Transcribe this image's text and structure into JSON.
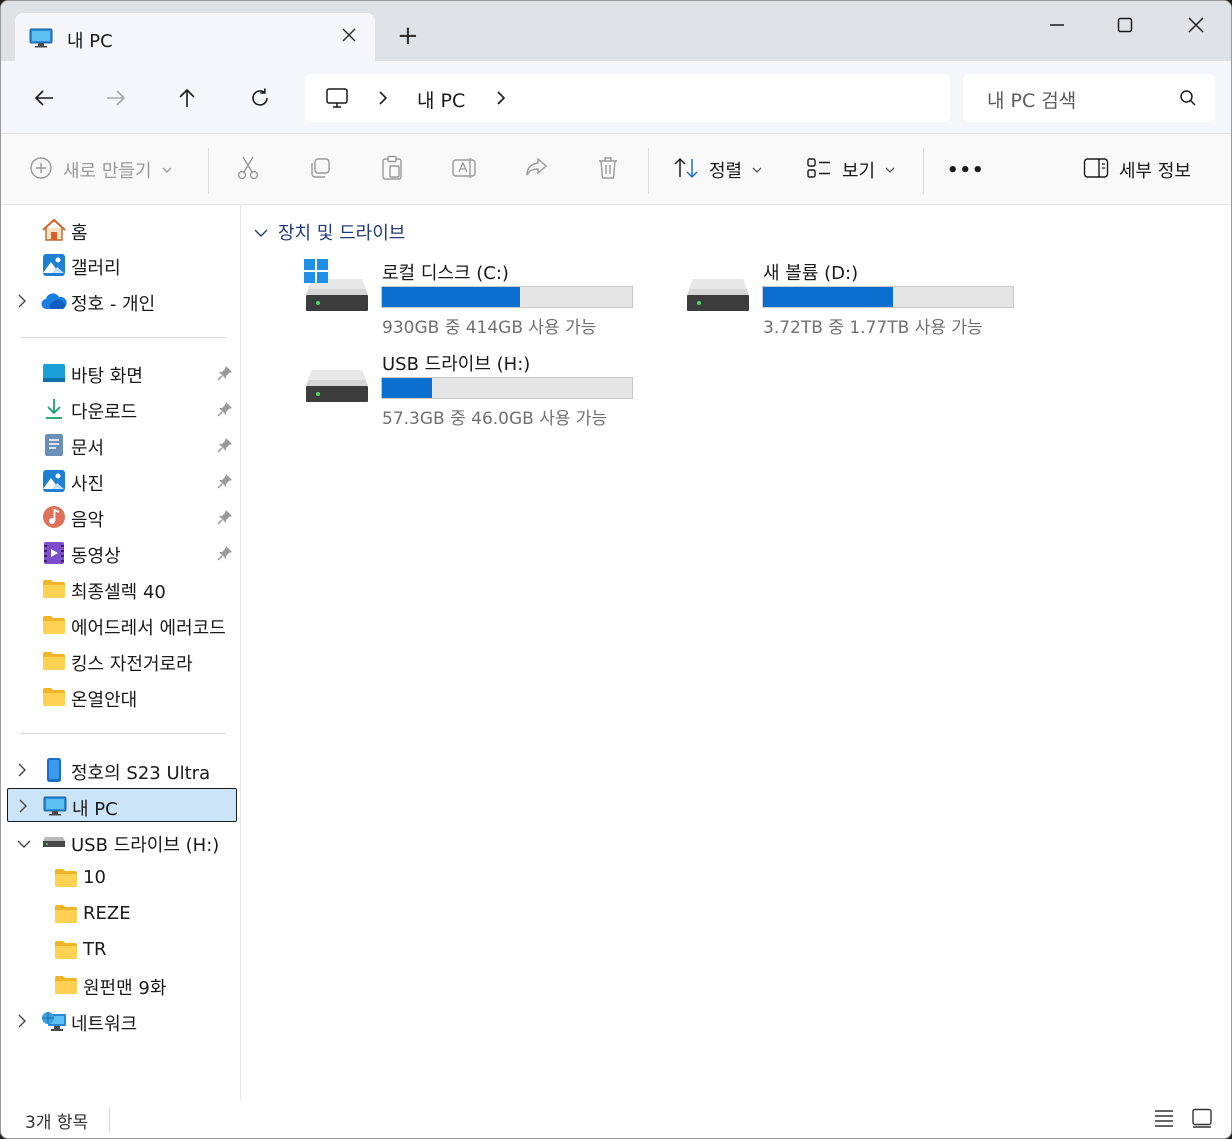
{
  "tab": {
    "title": "내 PC",
    "new_tab": "+"
  },
  "address": {
    "crumb": "내 PC"
  },
  "search": {
    "placeholder": "내 PC 검색"
  },
  "toolbar": {
    "new_label": "새로 만들기",
    "sort_label": "정렬",
    "view_label": "보기",
    "more_label": "•••",
    "details_label": "세부 정보"
  },
  "sidebar": {
    "home": "홈",
    "gallery": "갤러리",
    "onedrive": "정호 - 개인",
    "desktop": "바탕 화면",
    "downloads": "다운로드",
    "documents": "문서",
    "pictures": "사진",
    "music": "음악",
    "videos": "동영상",
    "folder1": "최종셀렉 40",
    "folder2": "에어드레서 에러코드",
    "folder3": "킹스 자전거로라",
    "folder4": "온열안대",
    "phone": "정호의 S23 Ultra",
    "thispc": "내 PC",
    "usb": "USB 드라이브 (H:)",
    "usb_sub1": "10",
    "usb_sub2": "REZE",
    "usb_sub3": "TR",
    "usb_sub4": "원펀맨 9화",
    "network": "네트워크"
  },
  "content": {
    "group_header": "장치 및 드라이브",
    "drives": [
      {
        "name": "로컬 디스크 (C:)",
        "size_text": "930GB 중 414GB 사용 가능",
        "used_fraction": 0.55
      },
      {
        "name": "새 볼륨 (D:)",
        "size_text": "3.72TB 중 1.77TB 사용 가능",
        "used_fraction": 0.52
      },
      {
        "name": "USB 드라이브 (H:)",
        "size_text": "57.3GB 중 46.0GB 사용 가능",
        "used_fraction": 0.2
      }
    ]
  },
  "status": {
    "item_count": "3개 항목"
  },
  "colors": {
    "accent": "#0a6fcf",
    "selected_bg": "#cce4f7",
    "group_header": "#1f3d7a"
  }
}
